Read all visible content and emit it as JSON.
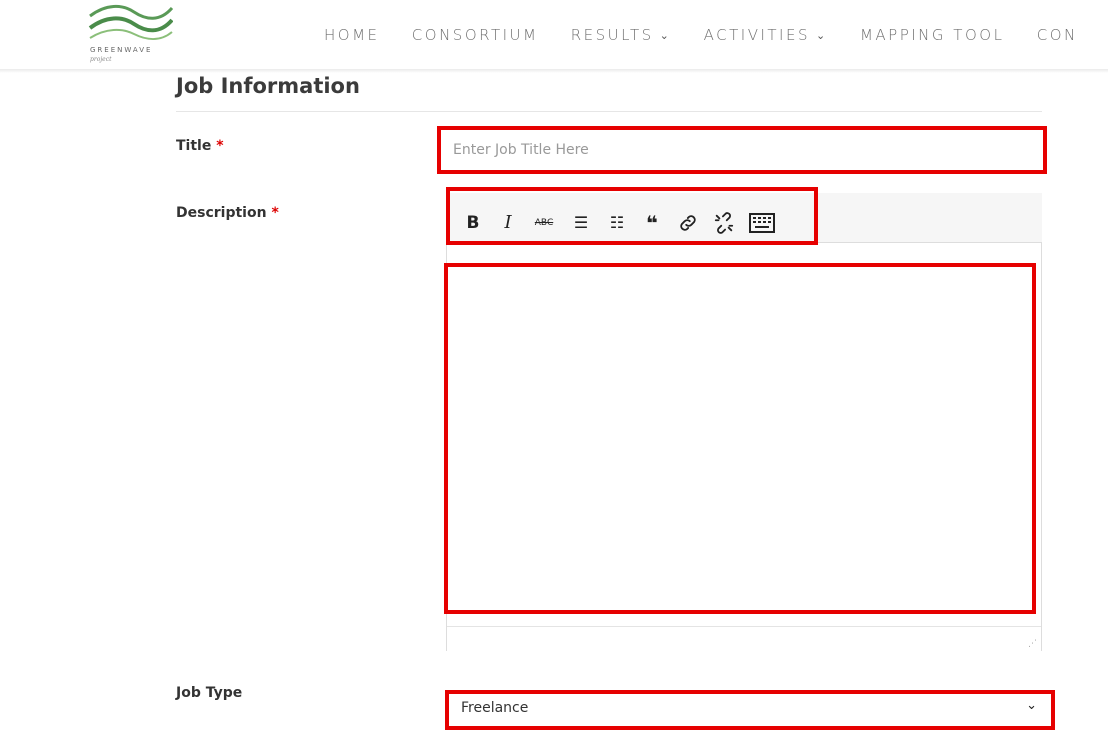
{
  "header": {
    "logo_text": "GREENWAVE",
    "logo_sub": "project",
    "nav": [
      {
        "label": "HOME",
        "has_dropdown": false
      },
      {
        "label": "CONSORTIUM",
        "has_dropdown": false
      },
      {
        "label": "RESULTS",
        "has_dropdown": true
      },
      {
        "label": "ACTIVITIES",
        "has_dropdown": true
      },
      {
        "label": "MAPPING TOOL",
        "has_dropdown": false
      },
      {
        "label": "CON",
        "has_dropdown": false
      }
    ],
    "dropdown_glyph": "⌄"
  },
  "form": {
    "section_title": "Job Information",
    "title_label": "Title",
    "required_mark": "*",
    "title_placeholder": "Enter Job Title Here",
    "title_value": "",
    "description_label": "Description",
    "toolbar": [
      {
        "icon": "bold-icon",
        "glyph": "B"
      },
      {
        "icon": "italic-icon",
        "glyph": "I"
      },
      {
        "icon": "strikethrough-icon",
        "glyph": "ABC"
      },
      {
        "icon": "bullet-list-icon",
        "glyph": "☰"
      },
      {
        "icon": "numbered-list-icon",
        "glyph": "☷"
      },
      {
        "icon": "blockquote-icon",
        "glyph": "❝"
      },
      {
        "icon": "link-icon",
        "glyph": "🔗"
      },
      {
        "icon": "unlink-icon",
        "glyph": "⛓"
      },
      {
        "icon": "keyboard-icon",
        "glyph": "⌨"
      }
    ],
    "description_value": "",
    "resize_glyph": "⋰",
    "job_type_label": "Job Type",
    "job_type_value": "Freelance",
    "job_type_chevron": "⌄"
  },
  "colors": {
    "highlight": "#e60000",
    "required": "#d00000",
    "logo_green": "#4b9a4b"
  }
}
